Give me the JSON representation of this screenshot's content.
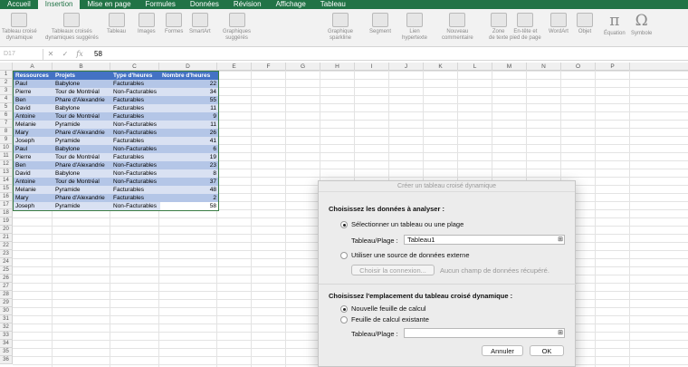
{
  "tabs": [
    "Accueil",
    "Insertion",
    "Mise en page",
    "Formules",
    "Données",
    "Révision",
    "Affichage",
    "Tableau"
  ],
  "ribbon": [
    {
      "label": "Tableau croisé\ndynamique",
      "icon": "pivot-table-icon"
    },
    {
      "label": "Tableaux croisés\ndynamiques suggérés",
      "icon": "suggested-pivot-icon"
    },
    {
      "label": "Tableau",
      "icon": "table-icon"
    },
    {
      "label": "Images",
      "icon": "image-icon"
    },
    {
      "label": "Formes",
      "icon": "shapes-icon"
    },
    {
      "label": "SmartArt",
      "icon": "smartart-icon"
    },
    {
      "label": "Graphiques\nsuggérés",
      "icon": "suggested-charts-icon"
    },
    {
      "label": "Graphique\nsparkline",
      "icon": "sparkline-icon"
    },
    {
      "label": "Segment",
      "icon": "slicer-icon"
    },
    {
      "label": "Lien\nhypertexte",
      "icon": "hyperlink-icon"
    },
    {
      "label": "Nouveau\ncommentaire",
      "icon": "comment-icon"
    },
    {
      "label": "Zone\nde texte",
      "icon": "textbox-icon"
    },
    {
      "label": "En-tête et\npied de page",
      "icon": "header-footer-icon"
    },
    {
      "label": "WordArt",
      "icon": "wordart-icon"
    },
    {
      "label": "Objet",
      "icon": "object-icon"
    },
    {
      "label": "Équation",
      "icon": "equation-icon"
    },
    {
      "label": "Symbole",
      "icon": "symbol-icon"
    }
  ],
  "formula_bar": {
    "cell": "D17",
    "value": "58",
    "fx": "fx",
    "cancel": "✕",
    "confirm": "✓"
  },
  "columns": [
    "A",
    "B",
    "C",
    "D",
    "E",
    "F",
    "G",
    "H",
    "I",
    "J",
    "K",
    "L",
    "M",
    "N",
    "O",
    "P"
  ],
  "rows": [
    "1",
    "2",
    "3",
    "4",
    "5",
    "6",
    "7",
    "8",
    "9",
    "10",
    "11",
    "12",
    "13",
    "14",
    "15",
    "16",
    "17",
    "18",
    "19",
    "20",
    "21",
    "22",
    "23",
    "24",
    "25",
    "26",
    "27",
    "28",
    "29",
    "30",
    "31",
    "32",
    "33",
    "34",
    "35",
    "36"
  ],
  "table": {
    "headers": [
      "Ressources",
      "Projets",
      "Type d'heures",
      "Nombre d'heures"
    ],
    "rows": [
      [
        "Paul",
        "Babylone",
        "Facturables",
        "22"
      ],
      [
        "Pierre",
        "Tour de Montréal",
        "Non-Facturables",
        "34"
      ],
      [
        "Ben",
        "Phare d'Alexandrie",
        "Facturables",
        "55"
      ],
      [
        "David",
        "Babylone",
        "Facturables",
        "11"
      ],
      [
        "Antoine",
        "Tour de Montréal",
        "Facturables",
        "9"
      ],
      [
        "Melanie",
        "Pyramide",
        "Non-Facturables",
        "11"
      ],
      [
        "Mary",
        "Phare d'Alexandrie",
        "Non-Facturables",
        "26"
      ],
      [
        "Joseph",
        "Pyramide",
        "Facturables",
        "41"
      ],
      [
        "Paul",
        "Babylone",
        "Non-Facturables",
        "6"
      ],
      [
        "Pierre",
        "Tour de Montréal",
        "Facturables",
        "19"
      ],
      [
        "Ben",
        "Phare d'Alexandrie",
        "Non-Facturables",
        "23"
      ],
      [
        "David",
        "Babylone",
        "Non-Facturables",
        "8"
      ],
      [
        "Antoine",
        "Tour de Montréal",
        "Non-Facturables",
        "37"
      ],
      [
        "Melanie",
        "Pyramide",
        "Facturables",
        "48"
      ],
      [
        "Mary",
        "Phare d'Alexandrie",
        "Facturables",
        "2"
      ],
      [
        "Joseph",
        "Pyramide",
        "Non-Facturables",
        "58"
      ]
    ]
  },
  "dialog": {
    "title": "Créer un tableau croisé dynamique",
    "section1": "Choisissez les données à analyser :",
    "opt_select": "Sélectionner un tableau ou une plage",
    "range_label": "Tableau/Plage :",
    "range_value": "Tableau1",
    "opt_external": "Utiliser une source de données externe",
    "choose_conn": "Choisir la connexion...",
    "no_fields": "Aucun champ de données récupéré.",
    "section2": "Choisissez l'emplacement du tableau croisé dynamique :",
    "opt_new_sheet": "Nouvelle feuille de calcul",
    "opt_existing": "Feuille de calcul existante",
    "dest_label": "Tableau/Plage :",
    "dest_value": "",
    "cancel": "Annuler",
    "ok": "OK"
  }
}
